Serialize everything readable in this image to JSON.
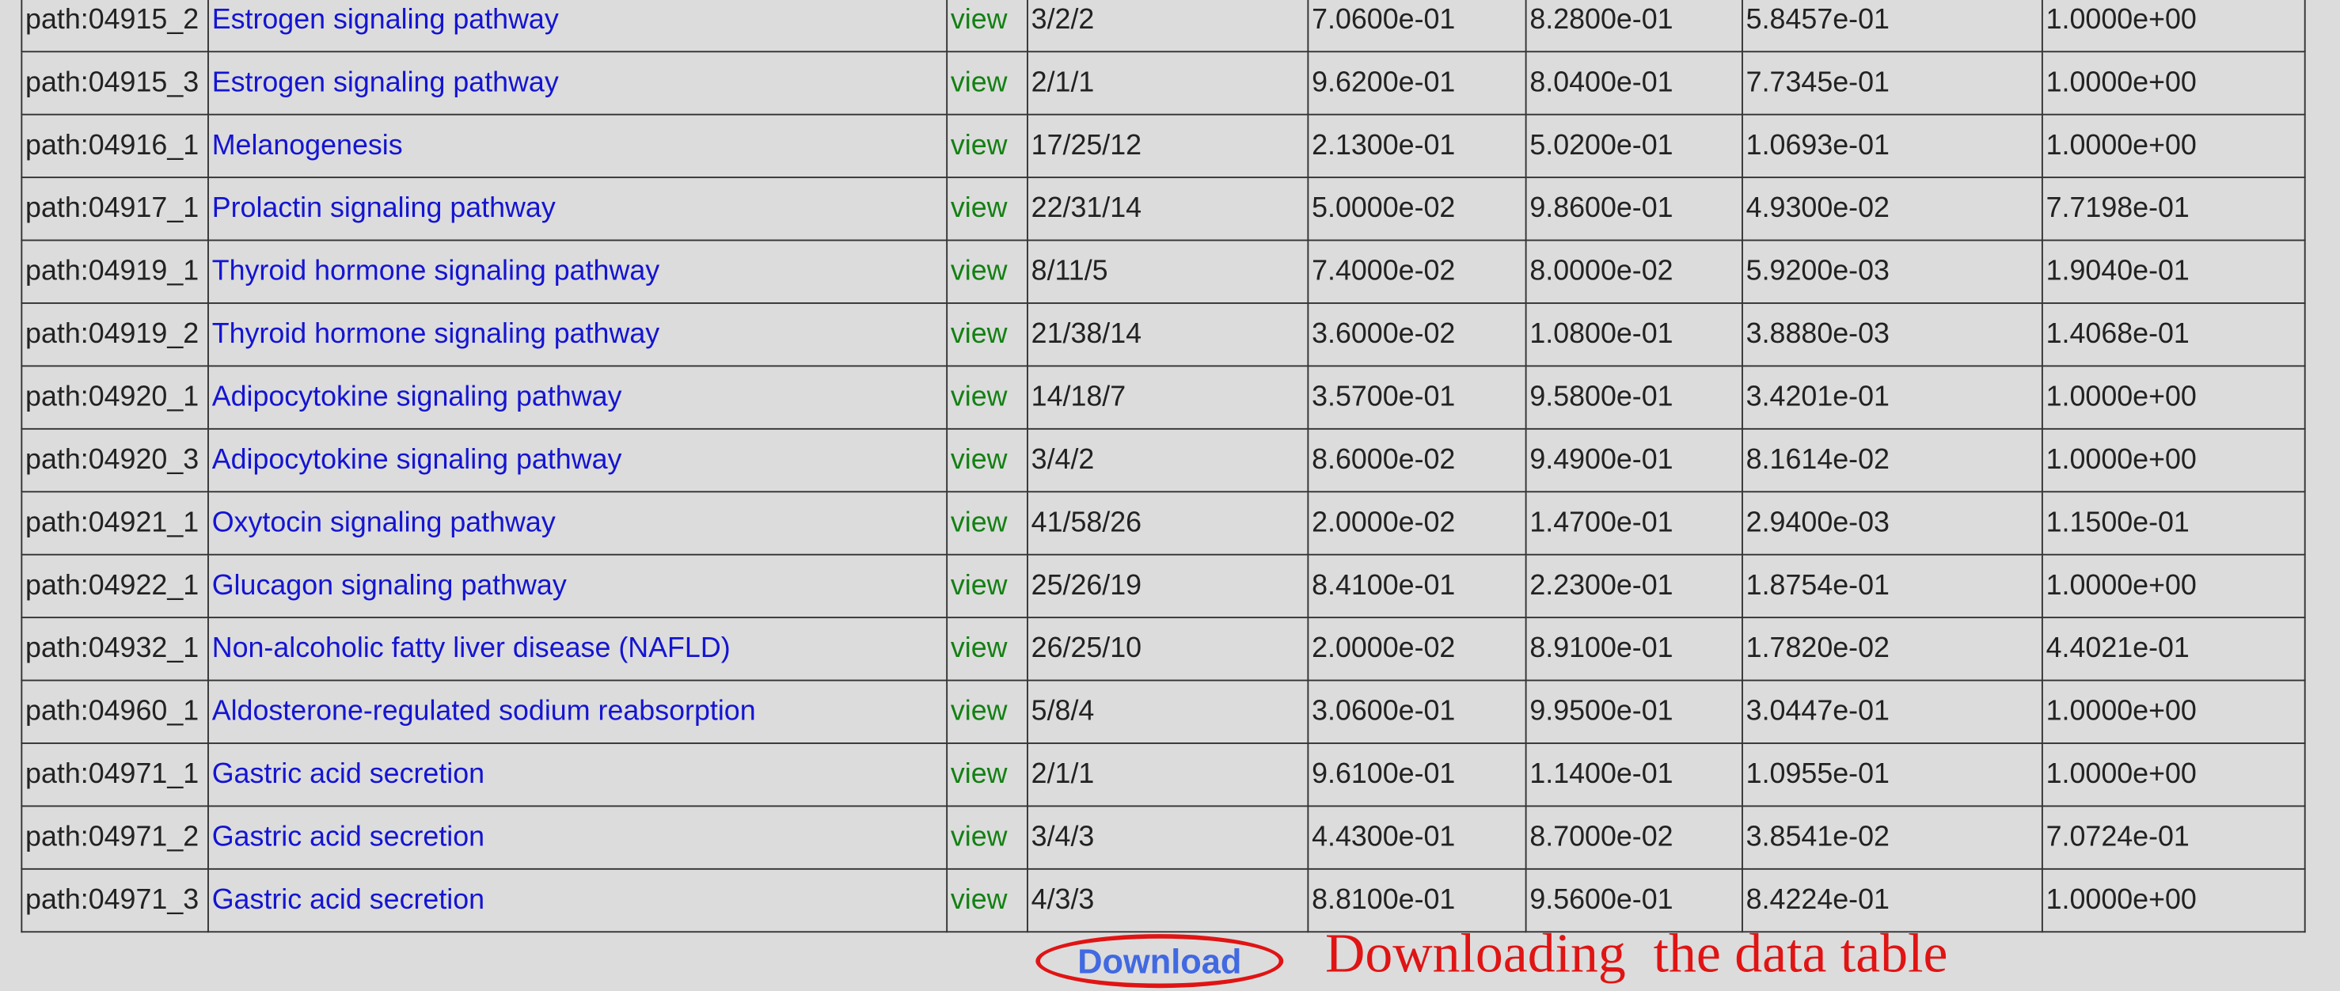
{
  "table": {
    "rows": [
      {
        "id": "path:04915_2",
        "name": "Estrogen signaling pathway",
        "view": "view",
        "count": "3/2/2",
        "v1": "7.0600e-01",
        "v2": "8.2800e-01",
        "v3": "5.8457e-01",
        "v4": "1.0000e+00"
      },
      {
        "id": "path:04915_3",
        "name": "Estrogen signaling pathway",
        "view": "view",
        "count": "2/1/1",
        "v1": "9.6200e-01",
        "v2": "8.0400e-01",
        "v3": "7.7345e-01",
        "v4": "1.0000e+00"
      },
      {
        "id": "path:04916_1",
        "name": "Melanogenesis",
        "view": "view",
        "count": "17/25/12",
        "v1": "2.1300e-01",
        "v2": "5.0200e-01",
        "v3": "1.0693e-01",
        "v4": "1.0000e+00"
      },
      {
        "id": "path:04917_1",
        "name": "Prolactin signaling pathway",
        "view": "view",
        "count": "22/31/14",
        "v1": "5.0000e-02",
        "v2": "9.8600e-01",
        "v3": "4.9300e-02",
        "v4": "7.7198e-01"
      },
      {
        "id": "path:04919_1",
        "name": "Thyroid hormone signaling pathway",
        "view": "view",
        "count": "8/11/5",
        "v1": "7.4000e-02",
        "v2": "8.0000e-02",
        "v3": "5.9200e-03",
        "v4": "1.9040e-01"
      },
      {
        "id": "path:04919_2",
        "name": "Thyroid hormone signaling pathway",
        "view": "view",
        "count": "21/38/14",
        "v1": "3.6000e-02",
        "v2": "1.0800e-01",
        "v3": "3.8880e-03",
        "v4": "1.4068e-01"
      },
      {
        "id": "path:04920_1",
        "name": "Adipocytokine signaling pathway",
        "view": "view",
        "count": "14/18/7",
        "v1": "3.5700e-01",
        "v2": "9.5800e-01",
        "v3": "3.4201e-01",
        "v4": "1.0000e+00"
      },
      {
        "id": "path:04920_3",
        "name": "Adipocytokine signaling pathway",
        "view": "view",
        "count": "3/4/2",
        "v1": "8.6000e-02",
        "v2": "9.4900e-01",
        "v3": "8.1614e-02",
        "v4": "1.0000e+00"
      },
      {
        "id": "path:04921_1",
        "name": "Oxytocin signaling pathway",
        "view": "view",
        "count": "41/58/26",
        "v1": "2.0000e-02",
        "v2": "1.4700e-01",
        "v3": "2.9400e-03",
        "v4": "1.1500e-01"
      },
      {
        "id": "path:04922_1",
        "name": "Glucagon signaling pathway",
        "view": "view",
        "count": "25/26/19",
        "v1": "8.4100e-01",
        "v2": "2.2300e-01",
        "v3": "1.8754e-01",
        "v4": "1.0000e+00"
      },
      {
        "id": "path:04932_1",
        "name": "Non-alcoholic fatty liver disease (NAFLD)",
        "view": "view",
        "count": "26/25/10",
        "v1": "2.0000e-02",
        "v2": "8.9100e-01",
        "v3": "1.7820e-02",
        "v4": "4.4021e-01"
      },
      {
        "id": "path:04960_1",
        "name": "Aldosterone-regulated sodium reabsorption",
        "view": "view",
        "count": "5/8/4",
        "v1": "3.0600e-01",
        "v2": "9.9500e-01",
        "v3": "3.0447e-01",
        "v4": "1.0000e+00"
      },
      {
        "id": "path:04971_1",
        "name": "Gastric acid secretion",
        "view": "view",
        "count": "2/1/1",
        "v1": "9.6100e-01",
        "v2": "1.1400e-01",
        "v3": "1.0955e-01",
        "v4": "1.0000e+00"
      },
      {
        "id": "path:04971_2",
        "name": "Gastric acid secretion",
        "view": "view",
        "count": "3/4/3",
        "v1": "4.4300e-01",
        "v2": "8.7000e-02",
        "v3": "3.8541e-02",
        "v4": "7.0724e-01"
      },
      {
        "id": "path:04971_3",
        "name": "Gastric acid secretion",
        "view": "view",
        "count": "4/3/3",
        "v1": "8.8100e-01",
        "v2": "9.5600e-01",
        "v3": "8.4224e-01",
        "v4": "1.0000e+00"
      }
    ]
  },
  "download": {
    "label": "Download",
    "annotation": "Downloading  the data table"
  },
  "colors": {
    "pathway_link": "#1414d2",
    "view_link": "#138013",
    "download_text": "#4169e1",
    "annotation": "#e01414",
    "background": "#dcdcdc"
  }
}
